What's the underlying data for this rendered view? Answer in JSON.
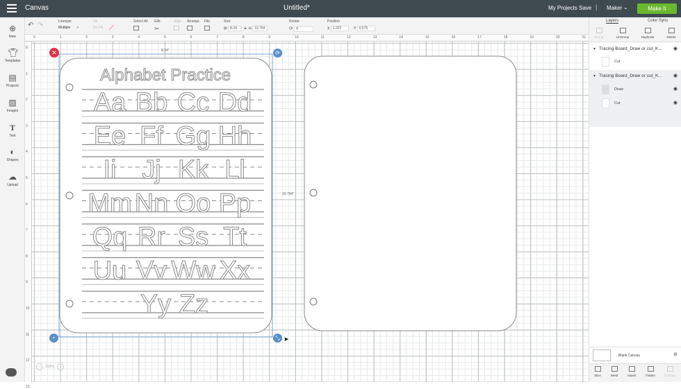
{
  "header": {
    "app_name": "Canvas",
    "title": "Untitled*",
    "my_projects": "My Projects",
    "save": "Save",
    "separator": "|",
    "machine": "Maker",
    "make_it": "Make It"
  },
  "toolbar": {
    "linetype_label": "Linetype",
    "linetype_value": "Multiple",
    "fill_label": "Fill",
    "fill_value": "No Fill",
    "select_all": "Select All",
    "edit": "Edit",
    "align": "Align",
    "arrange": "Arrange",
    "flip": "Flip",
    "size": "Size",
    "size_w_label": "W",
    "size_w": "8.34",
    "size_h_label": "H",
    "size_h": "10.794",
    "rotate": "Rotate",
    "rotate_value": "0",
    "position": "Position",
    "pos_x_label": "X",
    "pos_x": "1.022",
    "pos_y_label": "Y",
    "pos_y": "0.575"
  },
  "sidebar": {
    "items": [
      {
        "label": "New",
        "icon": "plus-circle-icon"
      },
      {
        "label": "Templates",
        "icon": "shirt-icon"
      },
      {
        "label": "Projects",
        "icon": "projects-icon"
      },
      {
        "label": "Images",
        "icon": "image-icon"
      },
      {
        "label": "Text",
        "icon": "text-icon"
      },
      {
        "label": "Shapes",
        "icon": "shapes-icon"
      },
      {
        "label": "Upload",
        "icon": "upload-cloud-icon"
      }
    ]
  },
  "rulers": {
    "top": [
      "0",
      "1",
      "2",
      "3",
      "4",
      "5",
      "6",
      "7",
      "8",
      "9",
      "10",
      "11",
      "12",
      "13",
      "14",
      "15",
      "16",
      "17",
      "18",
      "19",
      "20",
      "21"
    ],
    "left": [
      "0",
      "1",
      "2",
      "3",
      "4",
      "5",
      "6",
      "7",
      "8",
      "9",
      "10",
      "11",
      "12",
      "13"
    ]
  },
  "canvas": {
    "width_label": "8.34\"",
    "height_label": "10.794\"",
    "board_title": "Alphabet Practice",
    "letter_rows": [
      [
        "Aa",
        "Bb",
        "Cc",
        "Dd"
      ],
      [
        "Ee",
        "Ff",
        "Gg",
        "Hh"
      ],
      [
        "Ii",
        "Jj",
        "Kk",
        "Ll"
      ],
      [
        "Mm",
        "Nn",
        "Oo",
        "Pp"
      ],
      [
        "Qq",
        "Rr",
        "Ss",
        "Tt"
      ],
      [
        "Uu",
        "Vv",
        "Ww",
        "Xx"
      ],
      [
        "Yy",
        "Zz"
      ]
    ],
    "zoom": "100%"
  },
  "layers_panel": {
    "tab_layers": "Layers",
    "tab_color_sync": "Color Sync",
    "actions": [
      "Group",
      "UnGroup",
      "Duplicate",
      "Delete"
    ],
    "groups": [
      {
        "name": "Tracing Board_Draw or cut_K...",
        "items": [
          {
            "name": "Cut"
          }
        ]
      },
      {
        "name": "Tracing Board_Draw or cut_K...",
        "items": [
          {
            "name": "Draw"
          },
          {
            "name": "Cut"
          }
        ]
      }
    ],
    "blank_canvas": "Blank Canvas",
    "bottom_actions": [
      "Slice",
      "Weld",
      "Attach",
      "Flatten",
      "Contour"
    ]
  },
  "colors": {
    "topbar": "#3f4a50",
    "make_it": "#6ab82f",
    "selection": "#5b8fc9",
    "delete_handle": "#e0334c",
    "letter_outline": "#8a8a8a"
  }
}
